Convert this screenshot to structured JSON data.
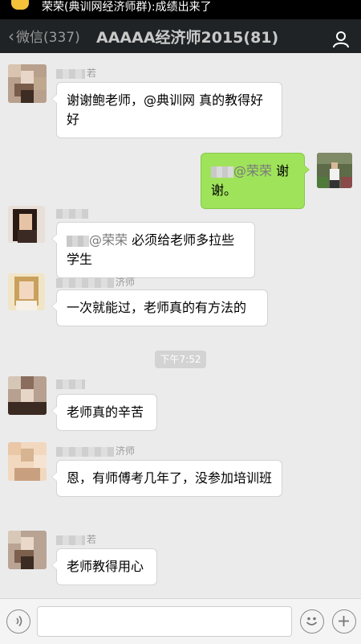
{
  "notification": {
    "text": "荣荣(典训网经济师群):成绩出来了"
  },
  "header": {
    "back_label": "微信(337)",
    "title": "AAAAA经济师2015(81)"
  },
  "messages": [
    {
      "sender": "若",
      "text": "谢谢鲍老师，@典训网 真的教得好好"
    },
    {
      "mention": "@荣荣",
      "text": "谢谢。"
    },
    {
      "mention": "@荣荣",
      "text": "必须给老师多拉些学生"
    },
    {
      "sender": "济师",
      "text": "一次就能过，老师真的有方法的"
    },
    {
      "sender": "",
      "text": "老师真的辛苦"
    },
    {
      "sender": "济师",
      "text": "恩，有师傅考几年了，没参加培训班"
    },
    {
      "sender": "若",
      "text": "老师教得用心"
    }
  ],
  "timestamp": "下午7:52",
  "input": {
    "placeholder": ""
  },
  "colors": {
    "accent_green": "#9fe35a",
    "navbar": "#1f2326",
    "background": "#ebebeb"
  },
  "icons": {
    "voice": "voice-icon",
    "emoji": "emoji-icon",
    "add": "plus-icon",
    "profile": "person-icon"
  }
}
